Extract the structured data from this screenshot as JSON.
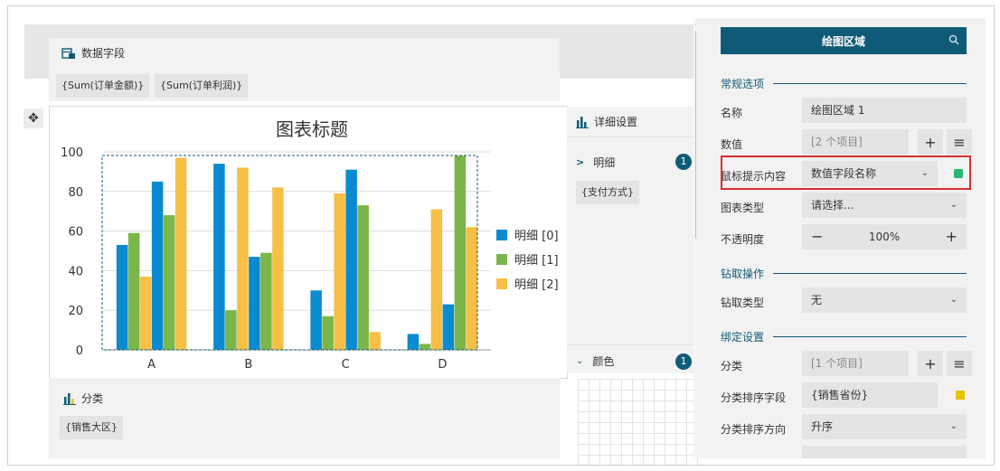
{
  "data_fields": {
    "title": "数据字段",
    "chips": [
      "{Sum(订单金额)}",
      "{Sum(订单利润)}"
    ]
  },
  "category_zone": {
    "title": "分类",
    "chips": [
      "{销售大区}"
    ]
  },
  "detail_panel": {
    "title": "详细设置",
    "rows": [
      {
        "label": "明细",
        "count": "1",
        "expanded": false
      },
      {
        "label": "颜色",
        "count": "1",
        "expanded": true
      }
    ],
    "chip": "{支付方式}"
  },
  "chart_data": {
    "type": "bar",
    "title": "图表标题",
    "categories": [
      "A",
      "B",
      "C",
      "D"
    ],
    "ylim": [
      0,
      100
    ],
    "yticks": [
      0,
      20,
      40,
      60,
      80,
      100
    ],
    "legend_position": "right",
    "groups": [
      {
        "category": "A",
        "bars": [
          {
            "series": "明细 [0]",
            "value": 53
          },
          {
            "series": "明细 [1]",
            "value": 59
          },
          {
            "series": "明细 [2]",
            "value": 37
          },
          {
            "series": "明细 [0]",
            "value": 85
          },
          {
            "series": "明细 [1]",
            "value": 68
          },
          {
            "series": "明细 [2]",
            "value": 97
          }
        ]
      },
      {
        "category": "B",
        "bars": [
          {
            "series": "明细 [0]",
            "value": 94
          },
          {
            "series": "明细 [1]",
            "value": 20
          },
          {
            "series": "明细 [2]",
            "value": 92
          },
          {
            "series": "明细 [0]",
            "value": 47
          },
          {
            "series": "明细 [1]",
            "value": 49
          },
          {
            "series": "明细 [2]",
            "value": 82
          }
        ]
      },
      {
        "category": "C",
        "bars": [
          {
            "series": "明细 [0]",
            "value": 30
          },
          {
            "series": "明细 [1]",
            "value": 17
          },
          {
            "series": "明细 [2]",
            "value": 79
          },
          {
            "series": "明细 [0]",
            "value": 91
          },
          {
            "series": "明细 [1]",
            "value": 73
          },
          {
            "series": "明细 [2]",
            "value": 9
          }
        ]
      },
      {
        "category": "D",
        "bars": [
          {
            "series": "明细 [0]",
            "value": 8
          },
          {
            "series": "明细 [1]",
            "value": 3
          },
          {
            "series": "明细 [2]",
            "value": 71
          },
          {
            "series": "明细 [0]",
            "value": 23
          },
          {
            "series": "明细 [1]",
            "value": 98
          },
          {
            "series": "明细 [2]",
            "value": 62
          }
        ]
      }
    ],
    "series": [
      {
        "name": "明细 [0]",
        "color": "#0a8ad0"
      },
      {
        "name": "明细 [1]",
        "color": "#7ab648"
      },
      {
        "name": "明细 [2]",
        "color": "#f5c045"
      }
    ]
  },
  "props": {
    "header": "绘图区域",
    "search_icon": "search-icon",
    "sections": {
      "general": "常规选项",
      "drill": "钻取操作",
      "binding": "绑定设置"
    },
    "name_label": "名称",
    "name_value": "绘图区域 1",
    "values_label": "数值",
    "values_value": "[2 个项目]",
    "tooltip_label": "鼠标提示内容",
    "tooltip_value": "数值字段名称",
    "tooltip_color": "#2bb673",
    "chart_type_label": "图表类型",
    "chart_type_value": "请选择...",
    "opacity_label": "不透明度",
    "opacity_value": "100%",
    "drill_type_label": "钻取类型",
    "drill_type_value": "无",
    "category_label": "分类",
    "category_value": "[1 个项目]",
    "category_sort_field_label": "分类排序字段",
    "category_sort_field_value": "{销售省份}",
    "category_sort_field_color": "#e6c200",
    "category_sort_dir_label": "分类排序方向",
    "category_sort_dir_value": "升序",
    "highlight_color": "#d9302c"
  }
}
